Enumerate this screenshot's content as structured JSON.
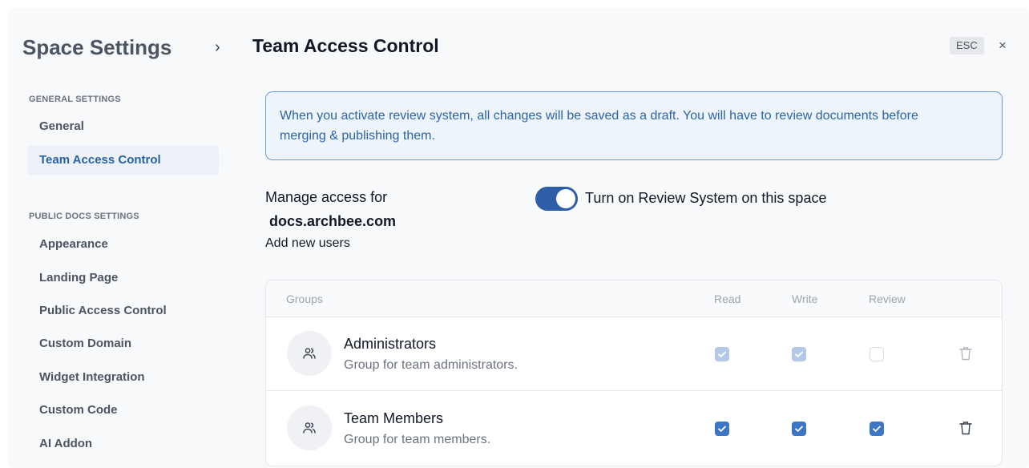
{
  "header": {
    "space_title": "Space Settings",
    "chevron": "›",
    "page_title": "Team Access Control",
    "esc_label": "ESC",
    "close_glyph": "×"
  },
  "sidebar": {
    "general_section": "GENERAL SETTINGS",
    "general_items": [
      {
        "label": "General",
        "active": false
      },
      {
        "label": "Team Access Control",
        "active": true
      }
    ],
    "public_section": "PUBLIC DOCS SETTINGS",
    "public_items": [
      {
        "label": "Appearance"
      },
      {
        "label": "Landing Page"
      },
      {
        "label": "Public Access Control"
      },
      {
        "label": "Custom Domain"
      },
      {
        "label": "Widget Integration"
      },
      {
        "label": "Custom Code"
      },
      {
        "label": "AI Addon"
      }
    ]
  },
  "info": {
    "line1": "When you activate review system, all changes will be saved as a draft. You will have to review documents before",
    "line2": "merging & publishing them."
  },
  "manage": {
    "label": "Manage access for",
    "domain": "docs.archbee.com",
    "add_users": "Add new users",
    "toggle_label": "Turn on Review System on this space",
    "toggle_on": true
  },
  "table": {
    "columns": [
      "Groups",
      "Read",
      "Write",
      "Review"
    ],
    "rows": [
      {
        "name": "Administrators",
        "description": "Group for team administrators.",
        "read": "checked-disabled",
        "write": "checked-disabled",
        "review": "unchecked-disabled"
      },
      {
        "name": "Team Members",
        "description": "Group for team members.",
        "read": "checked",
        "write": "checked",
        "review": "checked"
      }
    ]
  },
  "colors": {
    "accent": "#2e5ea8",
    "checkbox_checked": "#3d76c6",
    "checkbox_disabled": "#b3c9e6",
    "info_text": "#2b64a8",
    "info_border": "#6b9bd0"
  },
  "icons": [
    "chevron-right-icon",
    "close-icon",
    "users-icon",
    "trash-icon",
    "check-icon"
  ]
}
